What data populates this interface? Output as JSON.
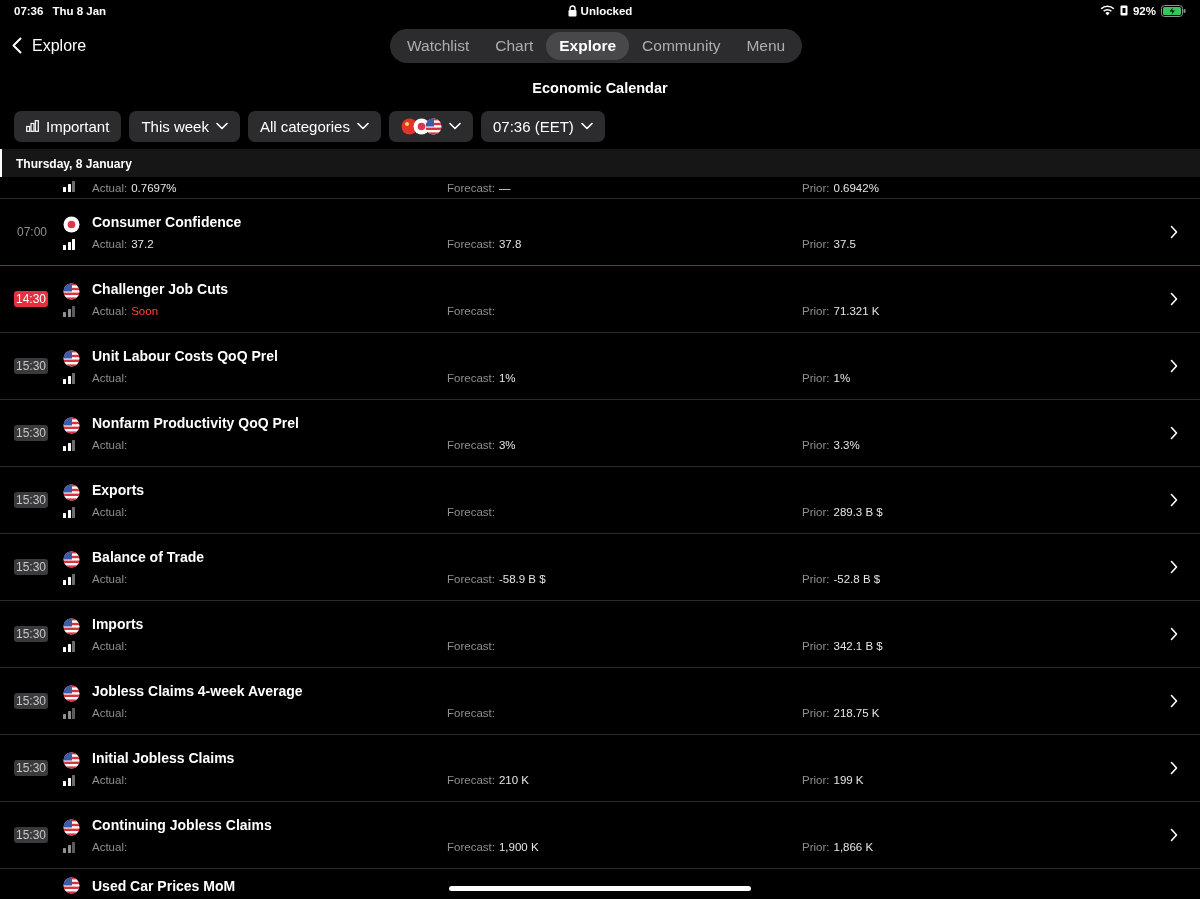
{
  "status_bar": {
    "time": "07:36",
    "date": "Thu 8 Jan",
    "lock_text": "Unlocked",
    "battery": "92%"
  },
  "nav": {
    "back_label": "Explore"
  },
  "tabs": [
    {
      "label": "Watchlist",
      "selected": false
    },
    {
      "label": "Chart",
      "selected": false
    },
    {
      "label": "Explore",
      "selected": true
    },
    {
      "label": "Community",
      "selected": false
    },
    {
      "label": "Menu",
      "selected": false
    }
  ],
  "page_title": "Economic Calendar",
  "filters": [
    {
      "kind": "importance",
      "label": "Important"
    },
    {
      "kind": "dropdown",
      "label": "This week"
    },
    {
      "kind": "dropdown",
      "label": "All categories"
    },
    {
      "kind": "flags"
    },
    {
      "kind": "dropdown",
      "label": "07:36 (EET)"
    }
  ],
  "day_header": "Thursday, 8 January",
  "events": [
    {
      "important": false,
      "dimmed": false,
      "actual_label": "Actual:",
      "actual": "0.7697%",
      "forecast_label": "Forecast:",
      "forecast": "—",
      "prior_label": "Prior:",
      "prior": "0.6942%"
    },
    {
      "time": "07:00",
      "badge": false,
      "soon": false,
      "kind": "jp",
      "title": "Consumer Confidence",
      "important": true,
      "dimmed": false,
      "actual_label": "Actual:",
      "actual": "37.2",
      "forecast_label": "Forecast:",
      "forecast": "37.8",
      "prior_label": "Prior:",
      "prior": "37.5",
      "now_marker": true
    },
    {
      "time": "14:30",
      "badge": true,
      "soon": true,
      "kind": "us",
      "title": "Challenger Job Cuts",
      "important": false,
      "dimmed": true,
      "actual_label": "Actual:",
      "actual": "Soon",
      "actual_soon": true,
      "forecast_label": "Forecast:",
      "prior_label": "Prior:",
      "prior": "71.321 K"
    },
    {
      "time": "15:30",
      "badge": true,
      "soon": false,
      "kind": "us",
      "title": "Unit Labour Costs QoQ Prel",
      "important": false,
      "dimmed": false,
      "actual_label": "Actual:",
      "forecast_label": "Forecast:",
      "forecast": "1%",
      "prior_label": "Prior:",
      "prior": "1%"
    },
    {
      "time": "15:30",
      "badge": true,
      "soon": false,
      "kind": "us",
      "title": "Nonfarm Productivity QoQ Prel",
      "important": false,
      "dimmed": false,
      "actual_label": "Actual:",
      "forecast_label": "Forecast:",
      "forecast": "3%",
      "prior_label": "Prior:",
      "prior": "3.3%"
    },
    {
      "time": "15:30",
      "badge": true,
      "soon": false,
      "kind": "us",
      "title": "Exports",
      "important": false,
      "dimmed": false,
      "actual_label": "Actual:",
      "forecast_label": "Forecast:",
      "prior_label": "Prior:",
      "prior": "289.3 B $"
    },
    {
      "time": "15:30",
      "badge": true,
      "soon": false,
      "kind": "us",
      "title": "Balance of Trade",
      "important": false,
      "dimmed": false,
      "actual_label": "Actual:",
      "forecast_label": "Forecast:",
      "forecast": "-58.9 B $",
      "prior_label": "Prior:",
      "prior": "-52.8 B $"
    },
    {
      "time": "15:30",
      "badge": true,
      "soon": false,
      "kind": "us",
      "title": "Imports",
      "important": false,
      "dimmed": false,
      "actual_label": "Actual:",
      "forecast_label": "Forecast:",
      "prior_label": "Prior:",
      "prior": "342.1 B $"
    },
    {
      "time": "15:30",
      "badge": true,
      "soon": false,
      "kind": "us",
      "title": "Jobless Claims 4-week Average",
      "important": false,
      "dimmed": true,
      "actual_label": "Actual:",
      "forecast_label": "Forecast:",
      "prior_label": "Prior:",
      "prior": "218.75 K"
    },
    {
      "time": "15:30",
      "badge": true,
      "soon": false,
      "kind": "us",
      "title": "Initial Jobless Claims",
      "important": false,
      "dimmed": false,
      "actual_label": "Actual:",
      "forecast_label": "Forecast:",
      "forecast": "210 K",
      "prior_label": "Prior:",
      "prior": "199 K"
    },
    {
      "time": "15:30",
      "badge": true,
      "soon": false,
      "kind": "us",
      "title": "Continuing Jobless Claims",
      "important": false,
      "dimmed": true,
      "actual_label": "Actual:",
      "forecast_label": "Forecast:",
      "forecast": "1,900 K",
      "prior_label": "Prior:",
      "prior": "1,866 K"
    },
    {
      "kind": "us",
      "title": "Used Car Prices MoM"
    }
  ]
}
